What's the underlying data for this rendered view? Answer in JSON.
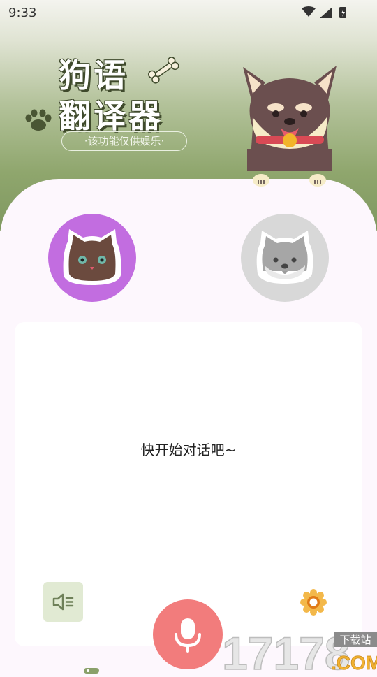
{
  "status_bar": {
    "time": "9:33"
  },
  "hero": {
    "title_line1": "狗语",
    "title_line2": "翻译器",
    "disclaimer": "·该功能仅供娱乐·"
  },
  "main": {
    "prompt": "快开始对话吧~"
  },
  "watermark": {
    "brand": "17178",
    "tag": "下载站",
    "domain": ".COM"
  },
  "colors": {
    "hero_green": "#8fa66d",
    "cat_avatar_bg": "#c26de0",
    "dog_avatar_bg": "#d8d8d8",
    "mic_button": "#f27c7c",
    "speaker_bg": "#e1ead3",
    "settings_gear": "#f0a92e"
  }
}
